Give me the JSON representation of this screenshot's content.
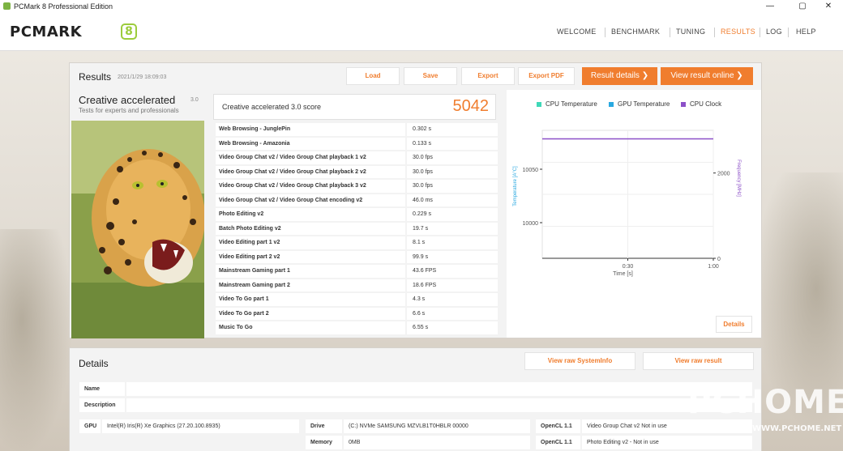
{
  "window": {
    "title": "PCMark 8 Professional Edition",
    "minimize": "—",
    "maximize": "▢",
    "close": "✕"
  },
  "logo": {
    "word": "PCMARK",
    "badge": "8"
  },
  "nav": {
    "items": [
      "WELCOME",
      "BENCHMARK",
      "TUNING",
      "RESULTS",
      "LOG",
      "HELP"
    ],
    "active": "RESULTS"
  },
  "results": {
    "title": "Results",
    "date": "2021/1/29 18:09:03",
    "buttons": {
      "load": "Load",
      "save": "Save",
      "export": "Export",
      "export_pdf": "Export PDF",
      "result_details": "Result details ❯",
      "view_online": "View result online ❯"
    },
    "benchmark": {
      "name": "Creative accelerated",
      "version": "3.0",
      "subtitle": "Tests for experts and professionals"
    },
    "score": {
      "label": "Creative accelerated 3.0 score",
      "value": "5042"
    },
    "rows": [
      {
        "name": "Web Browsing - JunglePin",
        "value": "0.302 s"
      },
      {
        "name": "Web Browsing - Amazonia",
        "value": "0.133 s"
      },
      {
        "name": "Video Group Chat v2 / Video Group Chat playback 1 v2",
        "value": "30.0 fps"
      },
      {
        "name": "Video Group Chat v2 / Video Group Chat playback 2 v2",
        "value": "30.0 fps"
      },
      {
        "name": "Video Group Chat v2 / Video Group Chat playback 3 v2",
        "value": "30.0 fps"
      },
      {
        "name": "Video Group Chat v2 / Video Group Chat encoding v2",
        "value": "46.0 ms"
      },
      {
        "name": "Photo Editing v2",
        "value": "0.229 s"
      },
      {
        "name": "Batch Photo Editing v2",
        "value": "19.7 s"
      },
      {
        "name": "Video Editing part 1 v2",
        "value": "8.1 s"
      },
      {
        "name": "Video Editing part 2 v2",
        "value": "99.9 s"
      },
      {
        "name": "Mainstream Gaming part 1",
        "value": "43.6 FPS"
      },
      {
        "name": "Mainstream Gaming part 2",
        "value": "18.6 FPS"
      },
      {
        "name": "Video To Go part 1",
        "value": "4.3 s"
      },
      {
        "name": "Video To Go part 2",
        "value": "6.6 s"
      },
      {
        "name": "Music To Go",
        "value": "6.55 s"
      }
    ],
    "details_button": "Details"
  },
  "chart_data": {
    "type": "line",
    "legend": [
      {
        "name": "CPU Temperature",
        "color": "#3fd8b8"
      },
      {
        "name": "GPU Temperature",
        "color": "#29a8e0"
      },
      {
        "name": "CPU Clock",
        "color": "#8c50c8"
      }
    ],
    "series": [
      {
        "name": "CPU Clock",
        "axis": "right",
        "x": [
          "0:00",
          "1:00"
        ],
        "values": [
          2800,
          2800
        ]
      }
    ],
    "x_ticks": [
      "0:30",
      "1:00"
    ],
    "xlabel": "Time [s]",
    "y_left": {
      "label": "Temperature [A°C]",
      "ticks": [
        "10050",
        "10000"
      ]
    },
    "y_right": {
      "label": "Frequency [MHz]",
      "ticks": [
        "2000",
        "0"
      ],
      "range": [
        0,
        3000
      ]
    },
    "grid": true
  },
  "details": {
    "title": "Details",
    "buttons": {
      "raw_sysinfo": "View raw SystemInfo",
      "raw_result": "View raw result"
    },
    "name_label": "Name",
    "description_label": "Description",
    "gpu_label": "GPU",
    "gpu_value": "Intel(R) Iris(R) Xe Graphics (27.20.100.8935)",
    "drive_label": "Drive",
    "drive_value": "(C:) NVMe SAMSUNG MZVLB1T0HBLR 00000",
    "memory_label": "Memory",
    "memory_value": "0MB",
    "opencl1_label": "OpenCL 1.1",
    "opencl1_value": "Video Group Chat v2   Not in use",
    "opencl2_label": "OpenCL 1.1",
    "opencl2_value": "Photo Editing v2 - Not in use"
  },
  "watermark": {
    "text": "PCHOME",
    "url": "WWW.PCHOME.NET"
  }
}
